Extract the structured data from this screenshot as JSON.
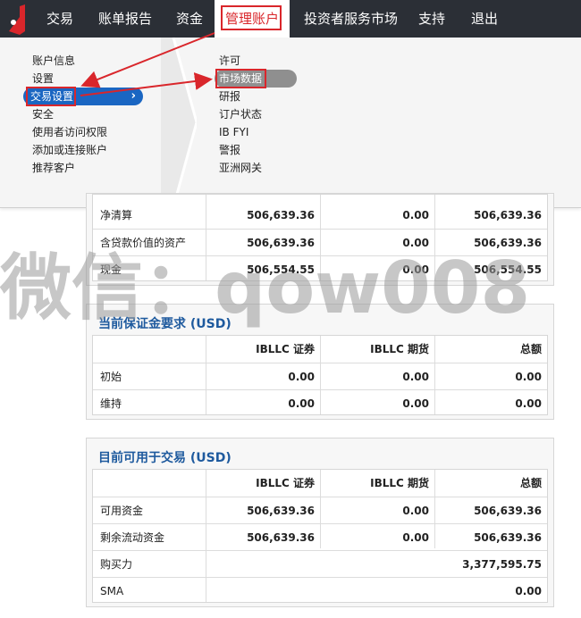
{
  "nav": {
    "items": [
      "交易",
      "账单报告",
      "资金",
      "管理账户",
      "投资者服务市场",
      "支持",
      "退出"
    ]
  },
  "menu": {
    "left": [
      "账户信息",
      "设置",
      "交易设置",
      "安全",
      "使用者访问权限",
      "添加或连接账户",
      "推荐客户"
    ],
    "right": [
      "许可",
      "市场数据",
      "研报",
      "订户状态",
      "IB FYI",
      "警报",
      "亚洲网关"
    ]
  },
  "colors": {
    "nav_bg": "#2b2f36",
    "highlight_red": "#d9262b",
    "selected_blue": "#1a66c2",
    "title_blue": "#1e5a9e"
  },
  "watermark": "微信：qow008",
  "top_table": {
    "rows": [
      [
        "净清算",
        "506,639.36",
        "0.00",
        "506,639.36"
      ],
      [
        "含贷款价值的资产",
        "506,639.36",
        "0.00",
        "506,639.36"
      ],
      [
        "现金",
        "506,554.55",
        "0.00",
        "506,554.55"
      ]
    ]
  },
  "margin_panel": {
    "title": "当前保证金要求 (USD)",
    "headers": [
      "",
      "IBLLC 证券",
      "IBLLC 期货",
      "总额"
    ],
    "rows": [
      [
        "初始",
        "0.00",
        "0.00",
        "0.00"
      ],
      [
        "维持",
        "0.00",
        "0.00",
        "0.00"
      ]
    ]
  },
  "available_panel": {
    "title": "目前可用于交易 (USD)",
    "headers": [
      "",
      "IBLLC 证券",
      "IBLLC 期货",
      "总额"
    ],
    "rows": [
      [
        "可用资金",
        "506,639.36",
        "0.00",
        "506,639.36"
      ],
      [
        "剩余流动资金",
        "506,639.36",
        "0.00",
        "506,639.36"
      ],
      [
        "购买力",
        "",
        "",
        "3,377,595.75"
      ],
      [
        "SMA",
        "",
        "",
        "0.00"
      ]
    ]
  }
}
